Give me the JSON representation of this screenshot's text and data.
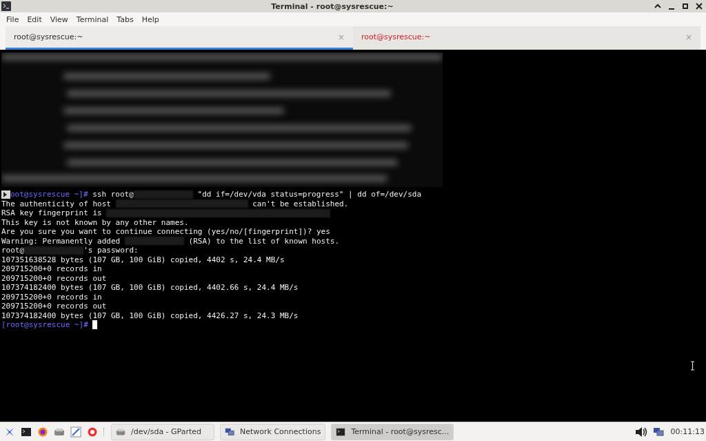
{
  "window": {
    "title": "Terminal - root@sysrescue:~"
  },
  "menu": [
    "File",
    "Edit",
    "View",
    "Terminal",
    "Tabs",
    "Help"
  ],
  "tabs": [
    {
      "label": "root@sysrescue:~",
      "selected": true,
      "activity": false,
      "close": "×"
    },
    {
      "label": "root@sysrescue:~",
      "selected": false,
      "activity": true,
      "close": "×"
    }
  ],
  "terminal": {
    "lines": [
      {
        "segments": [
          {
            "kind": "prompt",
            "text": "oot@sysrescue ~]#"
          },
          {
            "kind": "text",
            "text": " ssh root@"
          },
          {
            "kind": "redacted-short"
          },
          {
            "kind": "text",
            "text": " \"dd if=/dev/vda status=progress\" | dd of=/dev/sda"
          }
        ]
      },
      {
        "segments": [
          {
            "kind": "text",
            "text": "The authenticity of host "
          },
          {
            "kind": "redacted-long"
          },
          {
            "kind": "text",
            "text": " can't be established."
          }
        ]
      },
      {
        "segments": [
          {
            "kind": "text",
            "text": "RSA key fingerprint is "
          },
          {
            "kind": "redacted-xlong"
          }
        ]
      },
      {
        "segments": [
          {
            "kind": "text",
            "text": "This key is not known by any other names."
          }
        ]
      },
      {
        "segments": [
          {
            "kind": "text",
            "text": "Are you sure you want to continue connecting (yes/no/[fingerprint])? yes"
          }
        ]
      },
      {
        "segments": [
          {
            "kind": "text",
            "text": "Warning: Permanently added "
          },
          {
            "kind": "redacted-short"
          },
          {
            "kind": "text",
            "text": " (RSA) to the list of known hosts."
          }
        ]
      },
      {
        "segments": [
          {
            "kind": "text",
            "text": "root@"
          },
          {
            "kind": "redacted-short"
          },
          {
            "kind": "text",
            "text": "'s password:"
          }
        ]
      },
      {
        "segments": [
          {
            "kind": "text",
            "text": "107351638528 bytes (107 GB, 100 GiB) copied, 4402 s, 24.4 MB/s"
          }
        ]
      },
      {
        "segments": [
          {
            "kind": "text",
            "text": "209715200+0 records in"
          }
        ]
      },
      {
        "segments": [
          {
            "kind": "text",
            "text": "209715200+0 records out"
          }
        ]
      },
      {
        "segments": [
          {
            "kind": "text",
            "text": "107374182400 bytes (107 GB, 100 GiB) copied, 4402.66 s, 24.4 MB/s"
          }
        ]
      },
      {
        "segments": [
          {
            "kind": "text",
            "text": "209715200+0 records in"
          }
        ]
      },
      {
        "segments": [
          {
            "kind": "text",
            "text": "209715200+0 records out"
          }
        ]
      },
      {
        "segments": [
          {
            "kind": "text",
            "text": "107374182400 bytes (107 GB, 100 GiB) copied, 4426.27 s, 24.3 MB/s"
          }
        ]
      },
      {
        "segments": [
          {
            "kind": "prompt",
            "text": "[root@sysrescue ~]#"
          },
          {
            "kind": "cursor"
          }
        ]
      }
    ]
  },
  "taskbar": {
    "launchers": [
      {
        "kind": "menu"
      },
      {
        "kind": "terminal"
      },
      {
        "kind": "browser"
      },
      {
        "kind": "disk"
      },
      {
        "kind": "editor"
      },
      {
        "kind": "help"
      }
    ],
    "windows": [
      {
        "label": "/dev/sda - GParted",
        "kind": "disk",
        "selected": false
      },
      {
        "label": "Network Connections",
        "kind": "network",
        "selected": false
      },
      {
        "label": "Terminal - root@sysresc...",
        "kind": "terminal",
        "selected": true
      }
    ],
    "clock": "00:11:13"
  }
}
